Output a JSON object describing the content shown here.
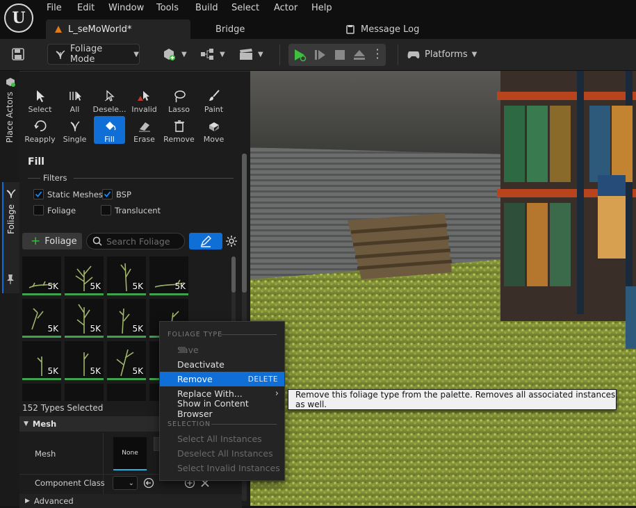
{
  "menu": [
    "File",
    "Edit",
    "Window",
    "Tools",
    "Build",
    "Select",
    "Actor",
    "Help"
  ],
  "tabs": {
    "level": "L_seMoWorld*",
    "bridge": "Bridge",
    "message_log": "Message Log"
  },
  "toolbar": {
    "mode_label": "Foliage Mode",
    "platforms_label": "Platforms"
  },
  "side_tabs": {
    "place_actors": "Place Actors",
    "foliage": "Foliage"
  },
  "tools": [
    {
      "label": "Select",
      "icon": "cursor-icon"
    },
    {
      "label": "All",
      "icon": "select-all-icon"
    },
    {
      "label": "Desele...",
      "icon": "deselect-icon"
    },
    {
      "label": "Invalid",
      "icon": "invalid-icon"
    },
    {
      "label": "Lasso",
      "icon": "lasso-icon"
    },
    {
      "label": "Paint",
      "icon": "brush-icon"
    },
    {
      "label": "Reapply",
      "icon": "reapply-icon"
    },
    {
      "label": "Single",
      "icon": "single-icon"
    },
    {
      "label": "Fill",
      "icon": "fill-icon",
      "active": true
    },
    {
      "label": "Erase",
      "icon": "eraser-icon"
    },
    {
      "label": "Remove",
      "icon": "trash-icon"
    },
    {
      "label": "Move",
      "icon": "move-icon"
    }
  ],
  "fill_panel": {
    "title": "Fill",
    "filters_label": "Filters",
    "filters": {
      "static_meshes": {
        "label": "Static Meshes",
        "checked": true
      },
      "bsp": {
        "label": "BSP",
        "checked": true
      },
      "foliage": {
        "label": "Foliage",
        "checked": false
      },
      "translucent": {
        "label": "Translucent",
        "checked": false
      }
    },
    "add_foliage_label": "Foliage",
    "search_placeholder": "Search Foliage"
  },
  "thumbnails": [
    "5K",
    "5K",
    "5K",
    "5K",
    "5K",
    "5K",
    "5K",
    "",
    "5K",
    "5K",
    "5K",
    "",
    "",
    "",
    "",
    ""
  ],
  "selection_status": "152 Types Selected",
  "details": {
    "mesh_section": "Mesh",
    "mesh_label": "Mesh",
    "mesh_value": "None",
    "component_class_label": "Component Class",
    "advanced_label": "Advanced"
  },
  "context_menu": {
    "foliage_type_header": "FOLIAGE TYPE",
    "save": "Save",
    "deactivate": "Deactivate",
    "remove": "Remove",
    "remove_shortcut": "DELETE",
    "replace_with": "Replace With...",
    "show_in_browser": "Show in Content Browser",
    "selection_header": "SELECTION",
    "select_all": "Select All Instances",
    "deselect_all": "Deselect All Instances",
    "select_invalid": "Select Invalid Instances"
  },
  "tooltip": "Remove this foliage type from the palette. Removes all associated instances as well.",
  "colors": {
    "accent": "#0f6fd6",
    "play_green": "#3fbf3f",
    "thumb_border": "#3fa34d"
  }
}
